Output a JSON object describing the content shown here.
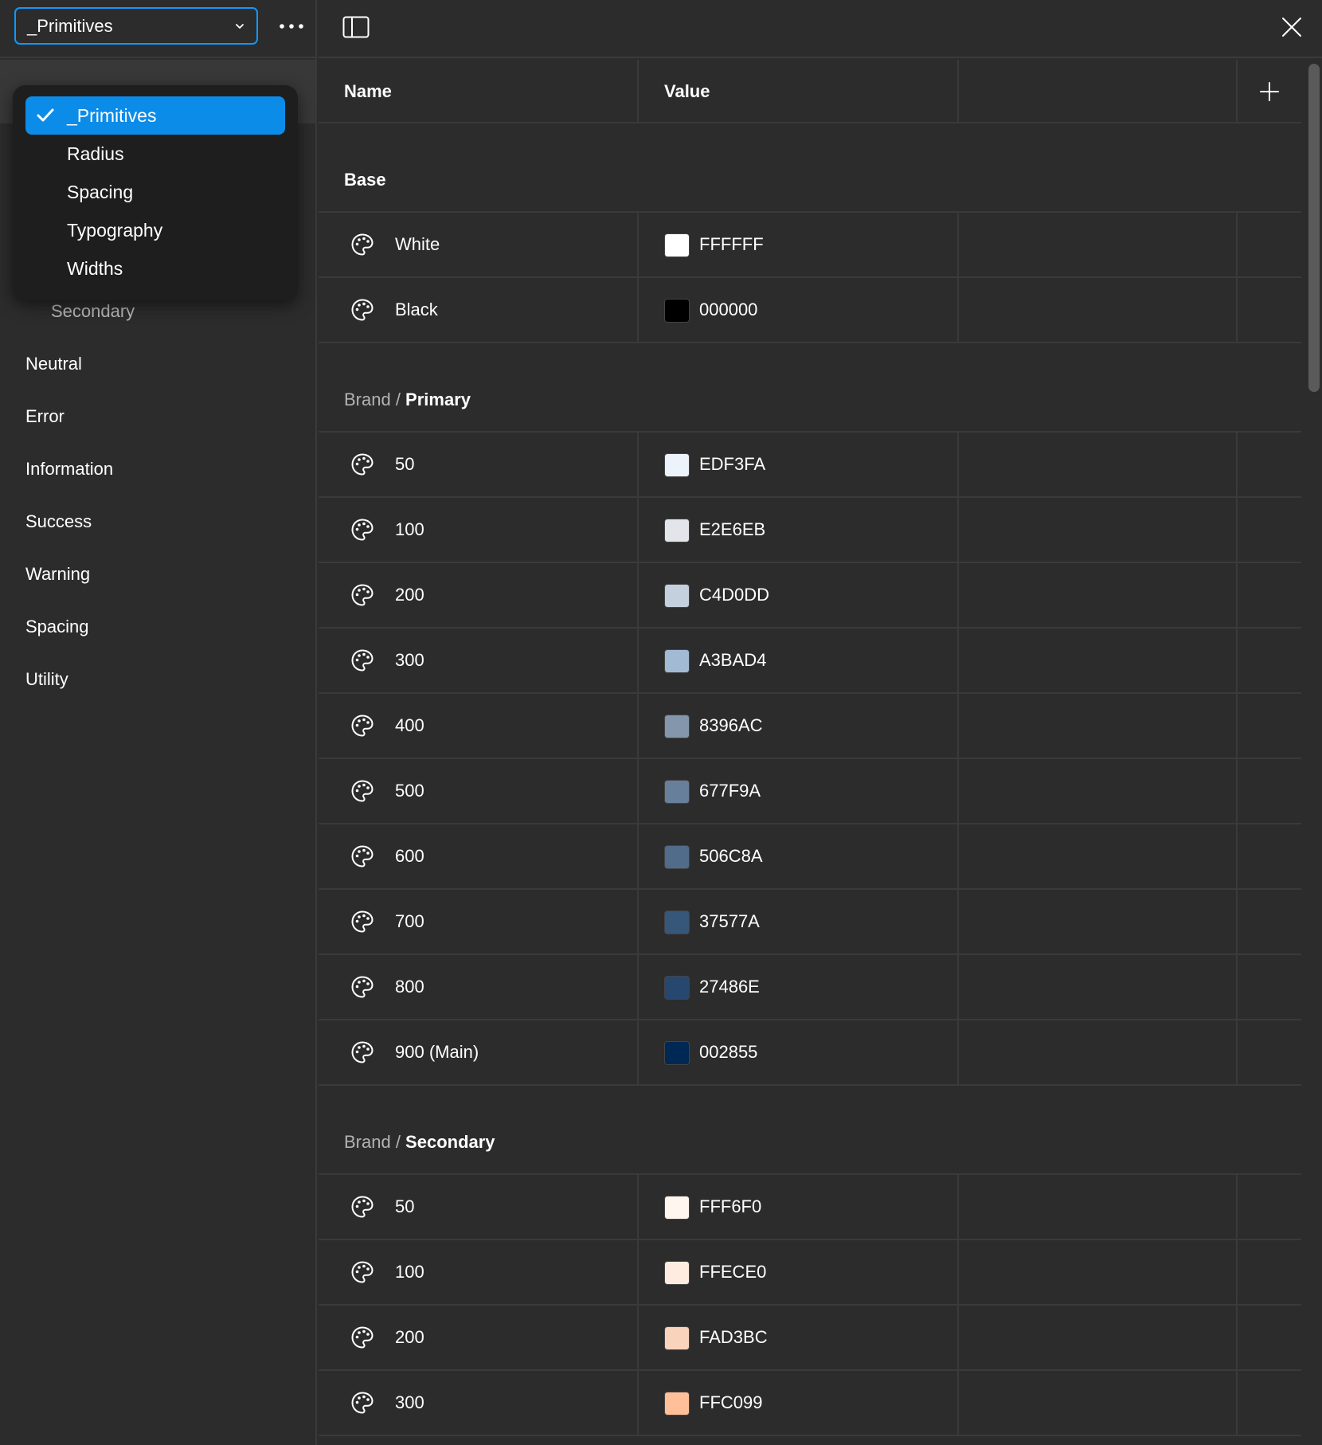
{
  "collection_select": {
    "label": "_Primitives"
  },
  "dropdown": {
    "items": [
      {
        "label": "_Primitives",
        "selected": true
      },
      {
        "label": "Radius",
        "selected": false
      },
      {
        "label": "Spacing",
        "selected": false
      },
      {
        "label": "Typography",
        "selected": false
      },
      {
        "label": "Widths",
        "selected": false
      }
    ]
  },
  "sidebar": {
    "items": [
      {
        "label": "Secondary",
        "sub": true
      },
      {
        "label": "Neutral",
        "sub": false
      },
      {
        "label": "Error",
        "sub": false
      },
      {
        "label": "Information",
        "sub": false
      },
      {
        "label": "Success",
        "sub": false
      },
      {
        "label": "Warning",
        "sub": false
      },
      {
        "label": "Spacing",
        "sub": false
      },
      {
        "label": "Utility",
        "sub": false
      }
    ]
  },
  "table": {
    "headers": {
      "name": "Name",
      "value": "Value"
    },
    "groups": [
      {
        "prefix": "",
        "title": "Base",
        "rows": [
          {
            "name": "White",
            "value": "FFFFFF",
            "color": "#FFFFFF"
          },
          {
            "name": "Black",
            "value": "000000",
            "color": "#000000"
          }
        ]
      },
      {
        "prefix": "Brand / ",
        "title": "Primary",
        "rows": [
          {
            "name": "50",
            "value": "EDF3FA",
            "color": "#EDF3FA"
          },
          {
            "name": "100",
            "value": "E2E6EB",
            "color": "#E2E6EB"
          },
          {
            "name": "200",
            "value": "C4D0DD",
            "color": "#C4D0DD"
          },
          {
            "name": "300",
            "value": "A3BAD4",
            "color": "#A3BAD4"
          },
          {
            "name": "400",
            "value": "8396AC",
            "color": "#8396AC"
          },
          {
            "name": "500",
            "value": "677F9A",
            "color": "#677F9A"
          },
          {
            "name": "600",
            "value": "506C8A",
            "color": "#506C8A"
          },
          {
            "name": "700",
            "value": "37577A",
            "color": "#37577A"
          },
          {
            "name": "800",
            "value": "27486E",
            "color": "#27486E"
          },
          {
            "name": "900 (Main)",
            "value": "002855",
            "color": "#002855"
          }
        ]
      },
      {
        "prefix": "Brand / ",
        "title": "Secondary",
        "rows": [
          {
            "name": "50",
            "value": "FFF6F0",
            "color": "#FFF6F0"
          },
          {
            "name": "100",
            "value": "FFECE0",
            "color": "#FFECE0"
          },
          {
            "name": "200",
            "value": "FAD3BC",
            "color": "#FAD3BC"
          },
          {
            "name": "300",
            "value": "FFC099",
            "color": "#FFC099"
          }
        ]
      }
    ]
  },
  "colors": {
    "accent": "#0d99ff",
    "selected_bg": "#0c8ce9",
    "panel_bg": "#2c2c2c",
    "menu_bg": "#1e1e1e"
  }
}
